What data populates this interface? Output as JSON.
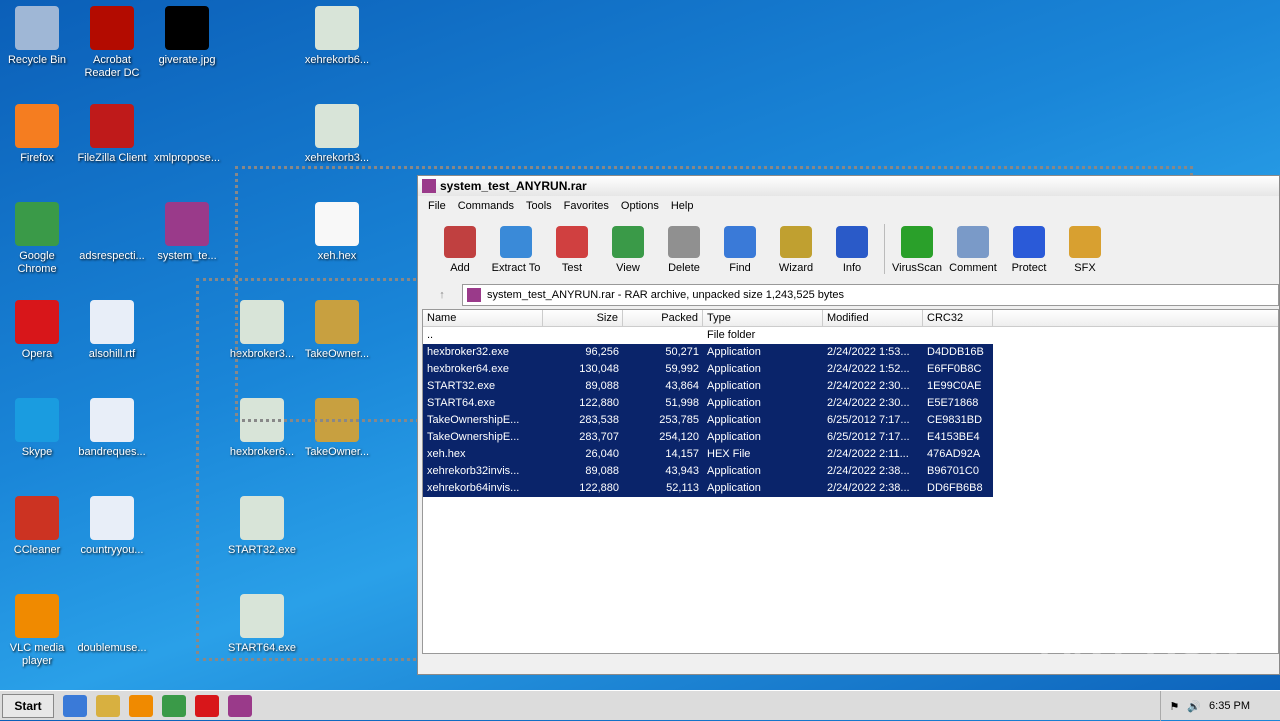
{
  "desktop_icons": [
    {
      "label": "Recycle Bin",
      "col": 0,
      "row": 0,
      "color": "#9fb7d6"
    },
    {
      "label": "Firefox",
      "col": 0,
      "row": 1,
      "color": "#f57d20"
    },
    {
      "label": "Google Chrome",
      "col": 0,
      "row": 2,
      "color": "#3a9a48"
    },
    {
      "label": "Opera",
      "col": 0,
      "row": 3,
      "color": "#d8161a"
    },
    {
      "label": "Skype",
      "col": 0,
      "row": 4,
      "color": "#1a9ce0"
    },
    {
      "label": "CCleaner",
      "col": 0,
      "row": 5,
      "color": "#cc3322"
    },
    {
      "label": "VLC media player",
      "col": 0,
      "row": 6,
      "color": "#f08a00"
    },
    {
      "label": "Acrobat Reader DC",
      "col": 1,
      "row": 0,
      "color": "#b30b00"
    },
    {
      "label": "FileZilla Client",
      "col": 1,
      "row": 1,
      "color": "#bf1a1a"
    },
    {
      "label": "adsrespecti...",
      "col": 1,
      "row": 2,
      "color": "transparent"
    },
    {
      "label": "alsohill.rtf",
      "col": 1,
      "row": 3,
      "color": "#e8eef8"
    },
    {
      "label": "bandreques...",
      "col": 1,
      "row": 4,
      "color": "#e8eef8"
    },
    {
      "label": "countryyou...",
      "col": 1,
      "row": 5,
      "color": "#e8eef8"
    },
    {
      "label": "doublemuse...",
      "col": 1,
      "row": 6,
      "color": "transparent"
    },
    {
      "label": "giverate.jpg",
      "col": 2,
      "row": 0,
      "color": "#000000"
    },
    {
      "label": "xmlpropose...",
      "col": 2,
      "row": 1,
      "color": "transparent"
    },
    {
      "label": "system_te...",
      "col": 2,
      "row": 2,
      "color": "#9a3a8a"
    },
    {
      "label": "hexbroker3...",
      "col": 3,
      "row": 3,
      "color": "#d8e4d8"
    },
    {
      "label": "hexbroker6...",
      "col": 3,
      "row": 4,
      "color": "#d8e4d8"
    },
    {
      "label": "START32.exe",
      "col": 3,
      "row": 5,
      "color": "#d8e4d8"
    },
    {
      "label": "START64.exe",
      "col": 3,
      "row": 6,
      "color": "#d8e4d8"
    },
    {
      "label": "xehrekorb6...",
      "col": 4,
      "row": 0,
      "color": "#d8e4d8"
    },
    {
      "label": "xehrekorb3...",
      "col": 4,
      "row": 1,
      "color": "#d8e4d8"
    },
    {
      "label": "xeh.hex",
      "col": 4,
      "row": 2,
      "color": "#f8f8f8"
    },
    {
      "label": "TakeOwner...",
      "col": 4,
      "row": 3,
      "color": "#c8a040"
    },
    {
      "label": "TakeOwner...",
      "col": 4,
      "row": 4,
      "color": "#c8a040"
    }
  ],
  "window": {
    "title": "system_test_ANYRUN.rar",
    "menu": [
      "File",
      "Commands",
      "Tools",
      "Favorites",
      "Options",
      "Help"
    ],
    "toolbar": [
      {
        "label": "Add",
        "color": "#c04040"
      },
      {
        "label": "Extract To",
        "color": "#3a8ad8"
      },
      {
        "label": "Test",
        "color": "#d04040"
      },
      {
        "label": "View",
        "color": "#3a9a48"
      },
      {
        "label": "Delete",
        "color": "#909090"
      },
      {
        "label": "Find",
        "color": "#3a7ad8"
      },
      {
        "label": "Wizard",
        "color": "#c0a030"
      },
      {
        "label": "Info",
        "color": "#2a5ac8"
      },
      {
        "label": "VirusScan",
        "color": "#2aa02a"
      },
      {
        "label": "Comment",
        "color": "#7a9ac8"
      },
      {
        "label": "Protect",
        "color": "#2a5ad8"
      },
      {
        "label": "SFX",
        "color": "#d8a030"
      }
    ],
    "address": "system_test_ANYRUN.rar - RAR archive, unpacked size 1,243,525 bytes",
    "columns": [
      "Name",
      "Size",
      "Packed",
      "Type",
      "Modified",
      "CRC32"
    ],
    "files": [
      {
        "name": "..",
        "size": "",
        "packed": "",
        "type": "File folder",
        "modified": "",
        "crc": "",
        "selected": false
      },
      {
        "name": "hexbroker32.exe",
        "size": "96,256",
        "packed": "50,271",
        "type": "Application",
        "modified": "2/24/2022 1:53...",
        "crc": "D4DDB16B",
        "selected": true
      },
      {
        "name": "hexbroker64.exe",
        "size": "130,048",
        "packed": "59,992",
        "type": "Application",
        "modified": "2/24/2022 1:52...",
        "crc": "E6FF0B8C",
        "selected": true
      },
      {
        "name": "START32.exe",
        "size": "89,088",
        "packed": "43,864",
        "type": "Application",
        "modified": "2/24/2022 2:30...",
        "crc": "1E99C0AE",
        "selected": true
      },
      {
        "name": "START64.exe",
        "size": "122,880",
        "packed": "51,998",
        "type": "Application",
        "modified": "2/24/2022 2:30...",
        "crc": "E5E71868",
        "selected": true
      },
      {
        "name": "TakeOwnershipE...",
        "size": "283,538",
        "packed": "253,785",
        "type": "Application",
        "modified": "6/25/2012 7:17...",
        "crc": "CE9831BD",
        "selected": true
      },
      {
        "name": "TakeOwnershipE...",
        "size": "283,707",
        "packed": "254,120",
        "type": "Application",
        "modified": "6/25/2012 7:17...",
        "crc": "E4153BE4",
        "selected": true
      },
      {
        "name": "xeh.hex",
        "size": "26,040",
        "packed": "14,157",
        "type": "HEX File",
        "modified": "2/24/2022 2:11...",
        "crc": "476AD92A",
        "selected": true
      },
      {
        "name": "xehrekorb32invis...",
        "size": "89,088",
        "packed": "43,943",
        "type": "Application",
        "modified": "2/24/2022 2:38...",
        "crc": "B96701C0",
        "selected": true
      },
      {
        "name": "xehrekorb64invis...",
        "size": "122,880",
        "packed": "52,113",
        "type": "Application",
        "modified": "2/24/2022 2:38...",
        "crc": "DD6FB6B8",
        "selected": true
      }
    ]
  },
  "taskbar": {
    "start": "Start",
    "clock": "6:35 PM",
    "apps": [
      "#3a7ad8",
      "#d8b040",
      "#f08a00",
      "#3a9a48",
      "#d8161a",
      "#9a3a8a"
    ]
  },
  "watermark": "ANY RUN"
}
